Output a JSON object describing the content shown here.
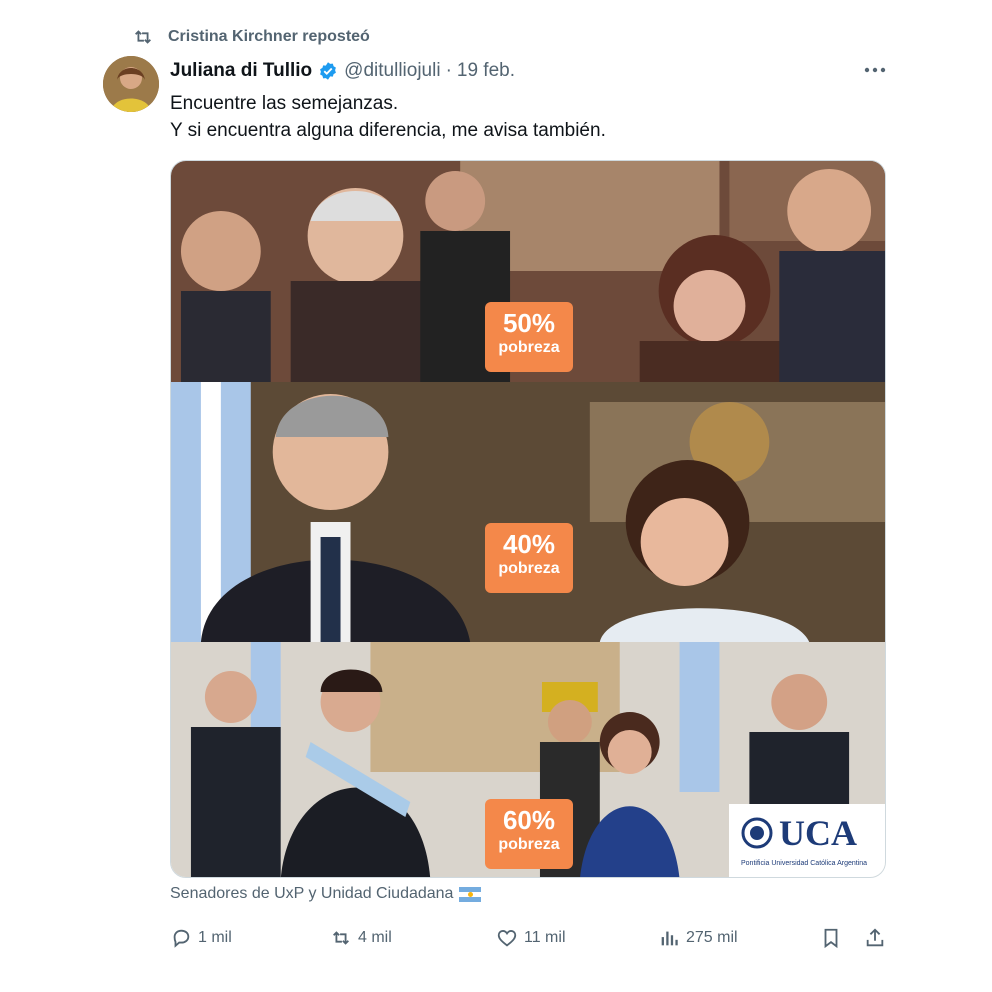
{
  "repost": {
    "text": "Cristina Kirchner reposteó",
    "icon": "repost-icon"
  },
  "author": {
    "name": "Juliana di Tullio",
    "handle": "@ditulliojuli",
    "separator": "·",
    "date": "19 feb.",
    "verified_color": "#1d9bf0"
  },
  "tweet": {
    "line1": "Encuentre las semejanzas.",
    "line2": "Y si encuentra alguna diferencia, me avisa también."
  },
  "panels": [
    {
      "percent": "50%",
      "label": "pobreza"
    },
    {
      "percent": "40%",
      "label": "pobreza"
    },
    {
      "percent": "60%",
      "label": "pobreza"
    }
  ],
  "logo": {
    "text": "UCA",
    "subtitle": "Pontificia Universidad Católica Argentina"
  },
  "caption": {
    "text": "Senadores de UxP y Unidad Ciudadana"
  },
  "actions": {
    "replies": "1 mil",
    "reposts": "4 mil",
    "likes": "11 mil",
    "views": "275 mil"
  },
  "colors": {
    "badge": "#f4884a",
    "muted": "#536471",
    "text": "#0f1419",
    "uca": "#1d3b78"
  }
}
